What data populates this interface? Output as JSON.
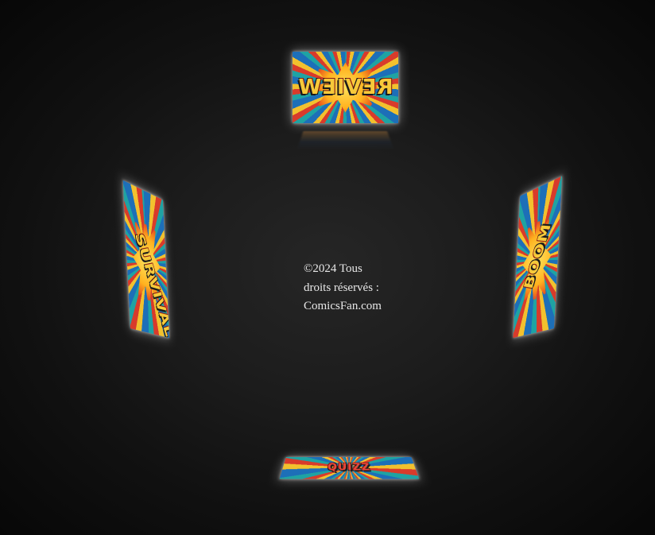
{
  "cards": [
    {
      "id": "top",
      "word": "REVIEW"
    },
    {
      "id": "left",
      "word": "SURVIVAL"
    },
    {
      "id": "right",
      "word": "BOOM"
    },
    {
      "id": "bottom",
      "word": "QUIZZ"
    }
  ],
  "footer": {
    "line1": "©2024 Tous",
    "line2": "droits réservés :",
    "line3": "ComicsFan.com"
  },
  "colors": {
    "background_center": "#262626",
    "background_edge": "#070707",
    "text": "#e8e8e8",
    "card_glow": "#ffffff"
  }
}
